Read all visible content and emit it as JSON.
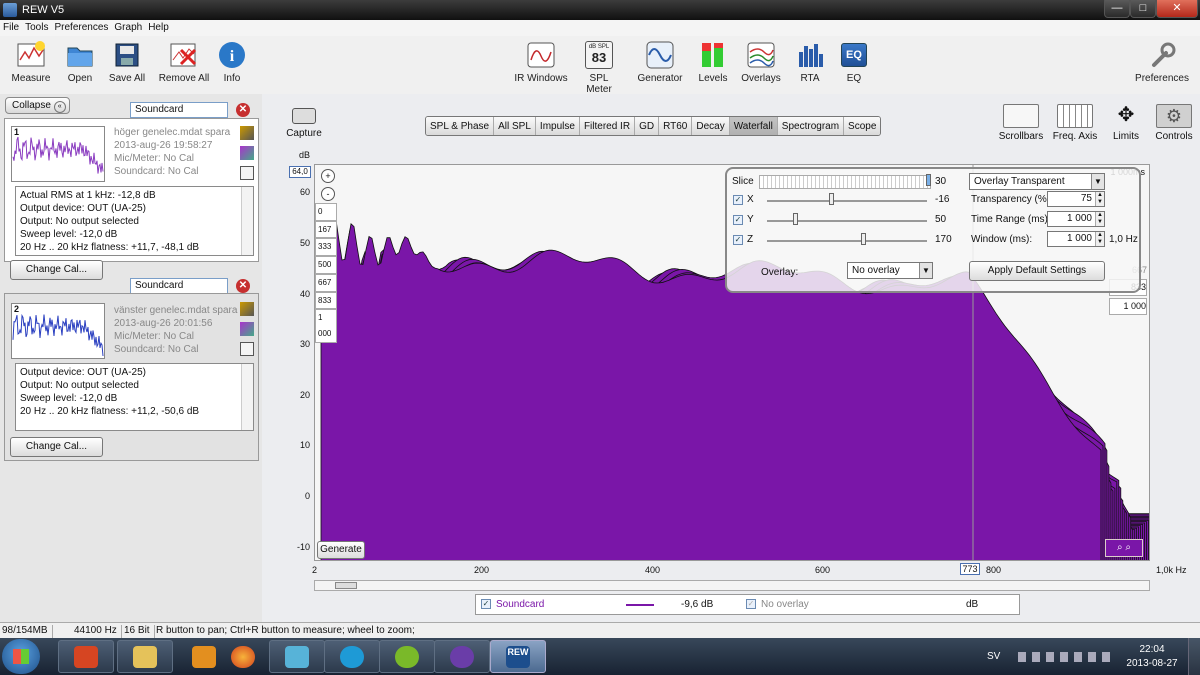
{
  "window": {
    "title": "REW V5"
  },
  "menu": [
    "File",
    "Tools",
    "Preferences",
    "Graph",
    "Help"
  ],
  "toolbar_left": [
    {
      "label": "Measure",
      "icon": "measure-icon"
    },
    {
      "label": "Open",
      "icon": "folder-icon"
    },
    {
      "label": "Save All",
      "icon": "save-icon"
    },
    {
      "label": "Remove All",
      "icon": "remove-all-icon"
    },
    {
      "label": "Info",
      "icon": "info-icon"
    }
  ],
  "toolbar_center": [
    {
      "label": "IR Windows",
      "icon": "ir-windows-icon"
    },
    {
      "label": "SPL Meter",
      "icon": "spl-meter-icon",
      "badge_top": "dB SPL",
      "badge_value": "83"
    },
    {
      "label": "Generator",
      "icon": "generator-icon"
    },
    {
      "label": "Levels",
      "icon": "levels-icon"
    },
    {
      "label": "Overlays",
      "icon": "overlays-icon"
    },
    {
      "label": "RTA",
      "icon": "rta-icon"
    },
    {
      "label": "EQ",
      "icon": "eq-icon",
      "badge_value": "EQ"
    }
  ],
  "toolbar_right": {
    "label": "Preferences",
    "icon": "wrench-icon"
  },
  "left_panel": {
    "collapse_label": "Collapse",
    "measurements": [
      {
        "number": "1",
        "soundcard": "Soundcard",
        "name": "höger genelec.mdat spara",
        "date": "2013-aug-26 19:58:27",
        "mic": "Mic/Meter: No Cal",
        "soundcard_cal": "Soundcard: No Cal",
        "info": [
          "Actual RMS at 1 kHz: -12,8 dB",
          "Output device: OUT (UA-25)",
          "Output: No output selected",
          "Sweep level: -12,0 dB",
          "20 Hz .. 20 kHz flatness: +11,7, -48,1 dB"
        ],
        "button": "Change Cal...",
        "trace_color": "#8a3cc0"
      },
      {
        "number": "2",
        "soundcard": "Soundcard",
        "name": "vänster genelec.mdat spara",
        "date": "2013-aug-26 20:01:56",
        "mic": "Mic/Meter: No Cal",
        "soundcard_cal": "Soundcard: No Cal",
        "info": [
          "Output device: OUT (UA-25)",
          "Output: No output selected",
          "Sweep level: -12,0 dB",
          "20 Hz .. 20 kHz flatness: +11,2, -50,6 dB"
        ],
        "button": "Change Cal...",
        "trace_color": "#2a3fc0"
      }
    ]
  },
  "capture_label": "Capture",
  "graph_tabs": [
    "SPL & Phase",
    "All SPL",
    "Impulse",
    "Filtered IR",
    "GD",
    "RT60",
    "Decay",
    "Waterfall",
    "Spectrogram",
    "Scope"
  ],
  "active_tab": "Waterfall",
  "graph_controls": [
    {
      "label": "Scrollbars",
      "icon": "scrollbars-icon"
    },
    {
      "label": "Freq. Axis",
      "icon": "freq-axis-icon"
    },
    {
      "label": "Limits",
      "icon": "limits-icon"
    },
    {
      "label": "Controls",
      "icon": "controls-gear-icon"
    }
  ],
  "plot": {
    "y_unit": "dB",
    "y_ticks": [
      "60",
      "50",
      "40",
      "30",
      "20",
      "10",
      "0",
      "-10"
    ],
    "x_ticks": [
      "2",
      "200",
      "400",
      "600",
      "800",
      "1,0k Hz"
    ],
    "top_value": "64,0",
    "cursor_value": "773",
    "right_top_label": "1 000ms",
    "z_ticks_left": [
      "0",
      "167",
      "333",
      "500",
      "667",
      "833",
      "1 000"
    ],
    "z_ticks_right": [
      "667",
      "833",
      "1 000"
    ],
    "generate_label": "Generate",
    "fill_color": "#7a16a8"
  },
  "overlay_panel": {
    "slice_label": "Slice",
    "slice_value": "30",
    "x_label": "X",
    "x_value": "-16",
    "y_label": "Y",
    "y_value": "50",
    "z_label": "Z",
    "z_value": "170",
    "overlay_label": "Overlay:",
    "overlay_select": "No overlay",
    "mode_select": "Overlay Transparent",
    "transparency_label": "Transparency (%)",
    "transparency_value": "75",
    "time_range_label": "Time Range (ms):",
    "time_range_value": "1 000",
    "window_label": "Window (ms):",
    "window_value": "1 000",
    "window_extra": "1,0 Hz",
    "apply_label": "Apply Default Settings"
  },
  "legend": {
    "name": "Soundcard",
    "value": "-9,6 dB",
    "overlay": "No overlay",
    "unit": "dB"
  },
  "status": {
    "memory": "98/154MB",
    "rate": "44100 Hz",
    "bits": "16 Bit",
    "hint": "R button to pan; Ctrl+R button to measure; wheel to zoom;"
  },
  "taskbar": {
    "lang": "SV",
    "time": "22:04",
    "date": "2013-08-27",
    "rew_label": "REW"
  }
}
